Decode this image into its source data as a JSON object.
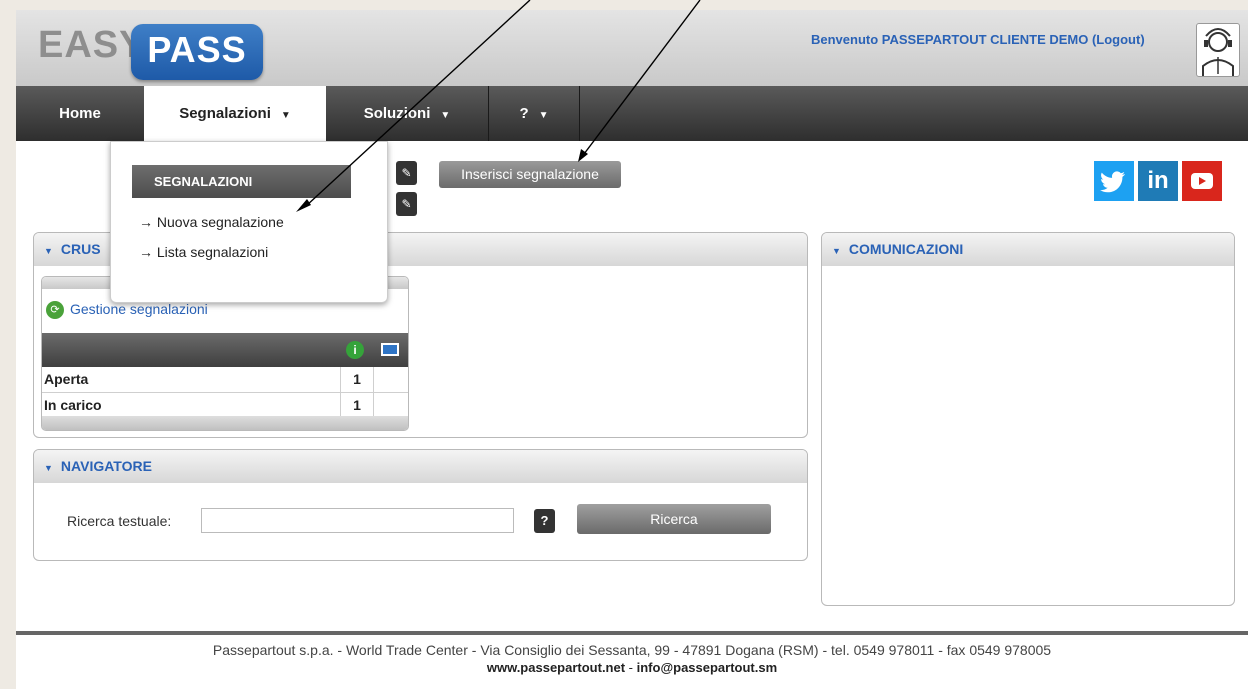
{
  "header": {
    "logo_easy": "EASY",
    "logo_pass": "PASS",
    "welcome": "Benvenuto PASSEPARTOUT CLIENTE DEMO (Logout)"
  },
  "nav": {
    "items": [
      {
        "label": "Home"
      },
      {
        "label": "Segnalazioni"
      },
      {
        "label": "Soluzioni"
      },
      {
        "label": "?"
      }
    ]
  },
  "dropdown": {
    "title": "SEGNALAZIONI",
    "items": [
      {
        "label": "Nuova segnalazione"
      },
      {
        "label": "Lista segnalazioni"
      }
    ]
  },
  "toolbar": {
    "insert_label": "Inserisci segnalazione"
  },
  "social": {
    "twitter": "twitter-icon",
    "linkedin_text": "in",
    "youtube": "youtube-icon"
  },
  "cruscotto": {
    "title_visible": "CRUS",
    "widget_title": "Gestione segnalazioni",
    "rows": [
      {
        "label": "Aperta",
        "count": "1"
      },
      {
        "label": "In carico",
        "count": "1"
      }
    ]
  },
  "comunicazioni": {
    "title": "COMUNICAZIONI"
  },
  "navigatore": {
    "title": "NAVIGATORE",
    "search_label": "Ricerca testuale:",
    "search_value": "",
    "help_label": "?",
    "search_button": "Ricerca"
  },
  "footer": {
    "line1": "Passepartout s.p.a. - World Trade Center - Via Consiglio dei Sessanta, 99 - 47891 Dogana (RSM) - tel. 0549 978011 - fax 0549 978005",
    "website": "www.passepartout.net",
    "separator": " - ",
    "email": "info@passepartout.sm"
  },
  "colors": {
    "link_blue": "#2a62b6",
    "twitter": "#1da1f2",
    "linkedin": "#1f7bb6",
    "youtube": "#d9261c"
  }
}
